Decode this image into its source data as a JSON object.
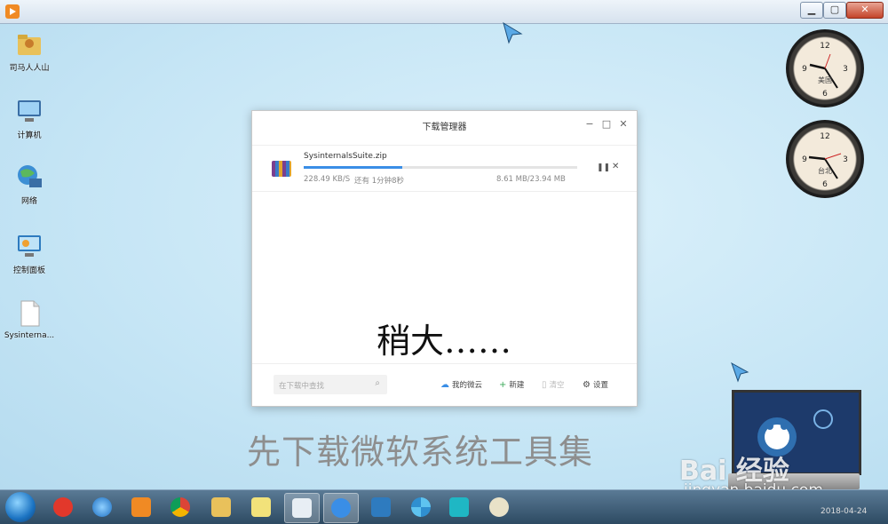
{
  "window": {
    "min_label": "▁",
    "max_label": "▢",
    "close_label": "✕"
  },
  "desktop_icons": [
    {
      "label": "司马人人山"
    },
    {
      "label": "计算机"
    },
    {
      "label": "网络"
    },
    {
      "label": "控制面板"
    },
    {
      "label": "Sysinterna..."
    }
  ],
  "clocks": [
    {
      "city": "美国"
    },
    {
      "city": "台北"
    }
  ],
  "dialog": {
    "title": "下载管理器",
    "controls": {
      "minimize": "−",
      "maximize": "□",
      "close": "✕"
    },
    "download": {
      "file_name": "SysinternalsSuite.zip",
      "progress": 0.36,
      "speed": "228.49 KB/S",
      "remaining": "还有 1分钟8秒",
      "size": "8.61 MB/23.94 MB",
      "pause_icon": "pause-icon",
      "cancel_icon": "close-icon"
    },
    "footer": {
      "search_placeholder": "在下载中查找",
      "cloud_label": "我的微云",
      "new_label": "新建",
      "clear_label": "清空",
      "settings_label": "设置"
    }
  },
  "caption_wait": "稍大……",
  "caption_main": "先下载微软系统工具集",
  "watermark": {
    "brand": "Bai 经验",
    "url": "jingyan.baidu.com"
  },
  "taskbar": {
    "date": "2018-04-24"
  },
  "colors": {
    "accent": "#3a8ee6",
    "desktop": "#c7e6f4"
  }
}
